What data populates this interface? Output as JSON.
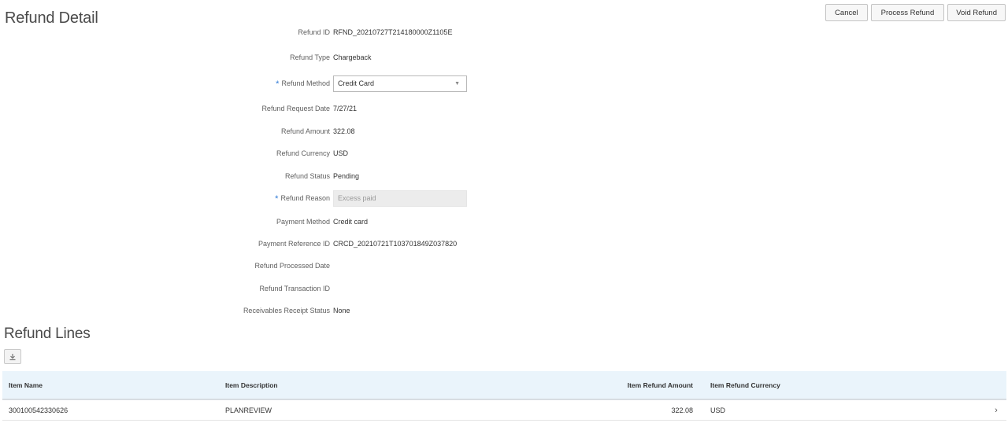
{
  "page": {
    "title": "Refund Detail"
  },
  "toolbar": {
    "cancel_label": "Cancel",
    "process_label": "Process Refund",
    "void_label": "Void Refund"
  },
  "form": {
    "refund_id": {
      "label": "Refund ID",
      "value": "RFND_20210727T214180000Z1105E"
    },
    "refund_type": {
      "label": "Refund Type",
      "value": "Chargeback"
    },
    "refund_method": {
      "label": "Refund Method",
      "required": true,
      "value": "Credit Card"
    },
    "refund_request_date": {
      "label": "Refund Request Date",
      "value": "7/27/21"
    },
    "refund_amount": {
      "label": "Refund Amount",
      "value": "322.08"
    },
    "refund_currency": {
      "label": "Refund Currency",
      "value": "USD"
    },
    "refund_status": {
      "label": "Refund Status",
      "value": "Pending"
    },
    "refund_reason": {
      "label": "Refund Reason",
      "required": true,
      "value": "Excess paid"
    },
    "payment_method": {
      "label": "Payment Method",
      "value": "Credit card"
    },
    "payment_reference_id": {
      "label": "Payment Reference ID",
      "value": "CRCD_20210721T103701849Z037820"
    },
    "refund_processed_date": {
      "label": "Refund Processed Date",
      "value": ""
    },
    "refund_transaction_id": {
      "label": "Refund Transaction ID",
      "value": ""
    },
    "receivables_receipt_status": {
      "label": "Receivables Receipt Status",
      "value": "None"
    },
    "required_marker": "*"
  },
  "refund_lines": {
    "title": "Refund Lines",
    "export_icon": "download-icon",
    "columns": [
      "Item Name",
      "Item Description",
      "Item Refund Amount",
      "Item Refund Currency"
    ],
    "rows": [
      {
        "item_name": "300100542330626",
        "item_description": "PLANREVIEW",
        "item_refund_amount": "322.08",
        "item_refund_currency": "USD",
        "chevron": "›"
      }
    ]
  }
}
